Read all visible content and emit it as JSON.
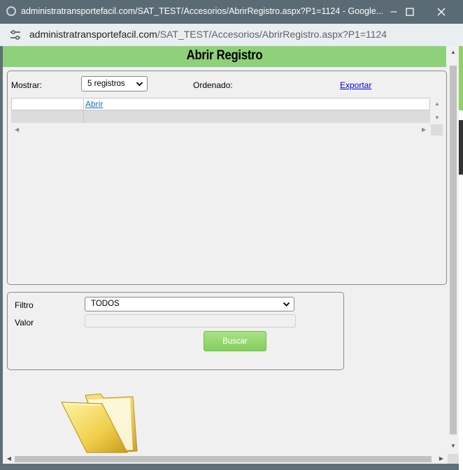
{
  "browser": {
    "title": "administratransportefacil.com/SAT_TEST/Accesorios/AbrirRegistro.aspx?P1=1124 - Google...",
    "url_domain": "administratransportefacil.com",
    "url_path": "/SAT_TEST/Accesorios/AbrirRegistro.aspx?P1=1124"
  },
  "header": {
    "title": "Abrir Registro"
  },
  "list": {
    "mostrar_label": "Mostrar:",
    "mostrar_value": "5 registros",
    "ordenado_label": "Ordenado:",
    "export_label": "Exportar",
    "grid_link": "Abrir"
  },
  "filter": {
    "filtro_label": "Filtro",
    "filtro_value": "TODOS",
    "valor_label": "Valor",
    "valor_value": "",
    "search_label": "Buscar"
  },
  "icons": [
    "tune-icon",
    "minimize-icon",
    "maximize-icon",
    "close-icon",
    "folder-icon",
    "chevron-down-icon"
  ],
  "colors": {
    "header_bg": "#8fd17a",
    "button_bg": "#84cf5c",
    "link": "#0000ee"
  }
}
